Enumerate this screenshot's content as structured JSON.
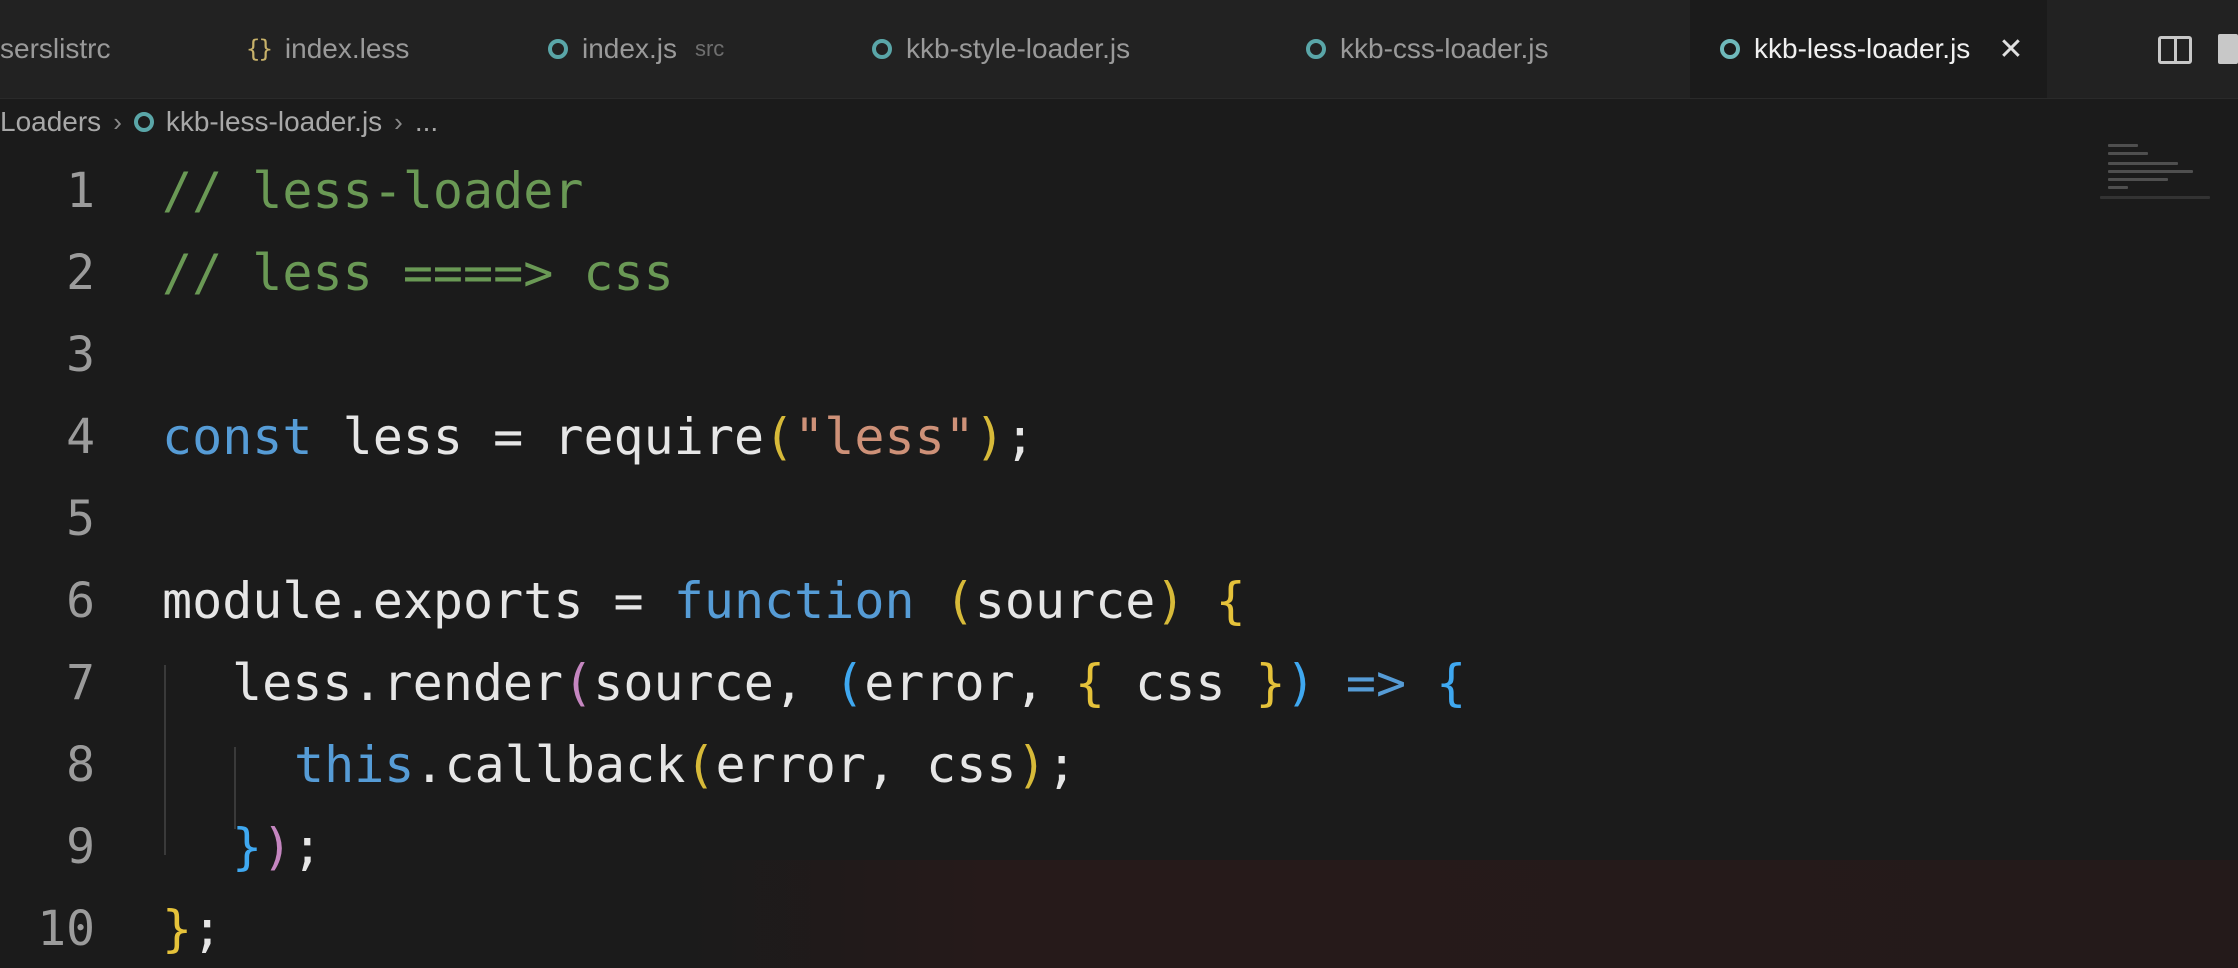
{
  "tabs": [
    {
      "label": "serslistrc",
      "icon": "none"
    },
    {
      "label": "index.less",
      "icon": "braces-icon"
    },
    {
      "label": "index.js",
      "hint": "src",
      "icon": "gear-icon"
    },
    {
      "label": "kkb-style-loader.js",
      "icon": "gear-icon"
    },
    {
      "label": "kkb-css-loader.js",
      "icon": "gear-icon"
    },
    {
      "label": "kkb-less-loader.js",
      "icon": "gear-icon",
      "active": true,
      "close": "✕"
    }
  ],
  "breadcrumb": {
    "folder": "Loaders",
    "file": "kkb-less-loader.js",
    "more": "..."
  },
  "editor": {
    "line_numbers": [
      "1",
      "2",
      "3",
      "4",
      "5",
      "6",
      "7",
      "8",
      "9",
      "10"
    ],
    "line1": "// less-loader",
    "line2": "// less ====> css",
    "line4": {
      "kw": "const",
      "name": " less = ",
      "fn": "require",
      "open": "(",
      "str": "\"less\"",
      "close": ")",
      "end": ";"
    },
    "line6": {
      "lhs": "module.exports = ",
      "kw": "function",
      "space": " ",
      "open": "(",
      "param": "source",
      "close": ")",
      "space2": " ",
      "brace": "{"
    },
    "line7": {
      "call": "less.render",
      "open": "(",
      "args1": "source, ",
      "open2": "(",
      "args2": "error, ",
      "brace_open": "{",
      "css": " css ",
      "brace_close": "}",
      "close2": ")",
      "arrow": " => ",
      "brace": "{"
    },
    "line8": {
      "kw": "this",
      "call": ".callback",
      "open": "(",
      "args": "error, css",
      "close": ")",
      "end": ";"
    },
    "line9": {
      "brace": "}",
      "close": ")",
      "end": ";"
    },
    "line10": {
      "brace": "}",
      "end": ";"
    }
  },
  "colors": {
    "background": "#1b1b1b",
    "comment": "#6a9955",
    "keyword": "#569cd6",
    "string": "#ce9178",
    "bracket_yellow": "#e5c23a",
    "bracket_purple": "#c586c0",
    "bracket_blue": "#3fa8f0"
  }
}
